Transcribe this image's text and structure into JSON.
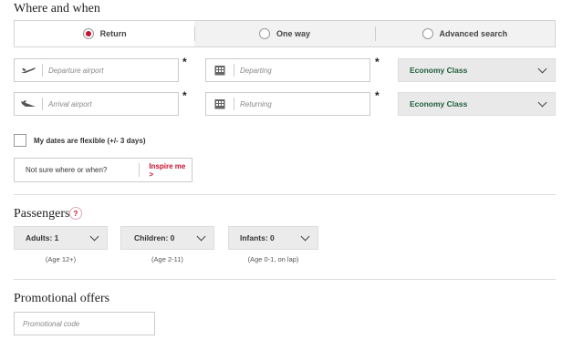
{
  "where_when": {
    "title": "Where and when",
    "trip_types": [
      {
        "label": "Return",
        "selected": true
      },
      {
        "label": "One way",
        "selected": false
      },
      {
        "label": "Advanced search",
        "selected": false
      }
    ],
    "departure_airport_placeholder": "Departure airport",
    "arrival_airport_placeholder": "Arrival airport",
    "departing_placeholder": "Departing",
    "returning_placeholder": "Returning",
    "required_marker": "*",
    "cabin_outbound": "Economy Class",
    "cabin_return": "Economy Class",
    "flexible_dates_label": "My dates are flexible (+/- 3 days)",
    "not_sure_text": "Not sure where or when?",
    "inspire_link": "Inspire me",
    "inspire_arrow": ">"
  },
  "passengers": {
    "title": "Passengers",
    "help_icon": "?",
    "adults": {
      "label": "Adults: 1",
      "note": "(Age 12+)"
    },
    "children": {
      "label": "Children: 0",
      "note": "(Age 2-11)"
    },
    "infants": {
      "label": "Infants: 0",
      "note": "(Age 0-1, on lap)"
    }
  },
  "promo": {
    "title": "Promotional offers",
    "placeholder": "Promotional code"
  },
  "colors": {
    "accent": "#c8102e",
    "cabin_text": "#1f5e3b"
  }
}
